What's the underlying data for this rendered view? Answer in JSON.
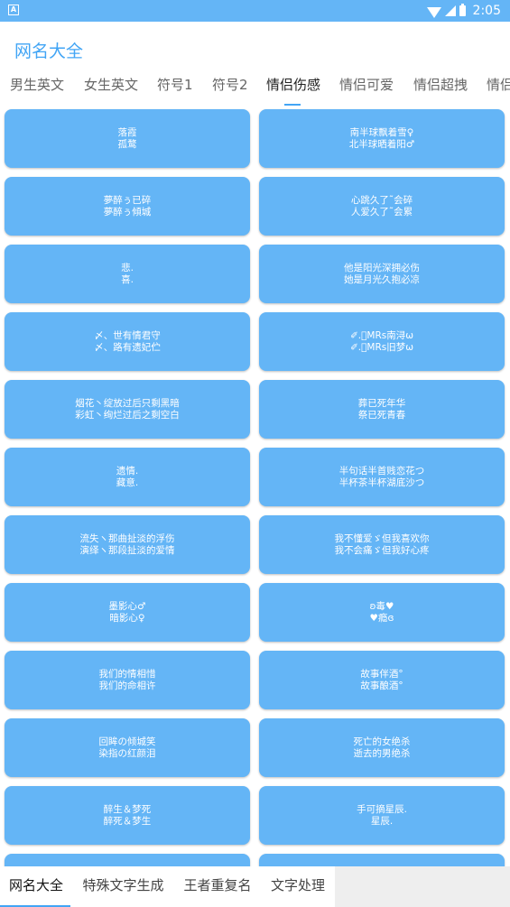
{
  "status_bar": {
    "notification_icon": "A",
    "time": "2:05",
    "icons": [
      "wifi-icon",
      "signal-icon",
      "battery-icon"
    ]
  },
  "app_bar": {
    "title": "网名大全"
  },
  "tabs": [
    {
      "label": "男生英文"
    },
    {
      "label": "女生英文"
    },
    {
      "label": "符号1"
    },
    {
      "label": "符号2"
    },
    {
      "label": "情侣伤感",
      "active": true
    },
    {
      "label": "情侣可爱"
    },
    {
      "label": "情侣超拽"
    },
    {
      "label": "情侣"
    }
  ],
  "cards": [
    {
      "line1": "落霞",
      "line2": "孤鹜"
    },
    {
      "line1": "南半球飘着雪♀",
      "line2": "北半球晒着阳♂"
    },
    {
      "line1": "夢醉ぅ已碎",
      "line2": "夢醉ぅ傾城"
    },
    {
      "line1": "心跳久了˜会碎",
      "line2": "人爱久了˜会累"
    },
    {
      "line1": "悲.",
      "line2": "喜."
    },
    {
      "line1": "他是阳光深拥必伤",
      "line2": "她是月光久抱必凉"
    },
    {
      "line1": "〆、世有情君守",
      "line2": "〆、路有遗妃伫"
    },
    {
      "line1": "✐.ﾞMRs南浔ω",
      "line2": "✐.ﾞMRs旧梦ω"
    },
    {
      "line1": "烟花丶绽放过后只剩黑暗",
      "line2": "彩虹丶绚烂过后之剩空白"
    },
    {
      "line1": "葬已死年华",
      "line2": "祭已死青春"
    },
    {
      "line1": "遗情.",
      "line2": "藏意."
    },
    {
      "line1": "半句话半首贱恋花つ",
      "line2": "半杯茶半杯湖底沙つ"
    },
    {
      "line1": "流失ヽ那曲扯淡的浮伤",
      "line2": "演绎ヽ那段扯淡的爱情"
    },
    {
      "line1": "我不懂爱ゞ但我喜欢你",
      "line2": "我不会痛ゞ但我好心疼"
    },
    {
      "line1": "墨影心♂",
      "line2": "暗影心♀"
    },
    {
      "line1": "ʚ毒♥",
      "line2": "♥瘾ɞ"
    },
    {
      "line1": "我们的情相惜",
      "line2": "我们的命相许"
    },
    {
      "line1": "故事伴酒°",
      "line2": "故事酿酒°"
    },
    {
      "line1": "回眸の倾城笑",
      "line2": "染指の红颜泪"
    },
    {
      "line1": "死亡的女绝杀",
      "line2": "逝去的男绝杀"
    },
    {
      "line1": "醉生＆梦死",
      "line2": "醉死＆梦生"
    },
    {
      "line1": "手可摘星辰.",
      "line2": "星辰."
    },
    {
      "line1": "",
      "line2": ""
    },
    {
      "line1": "",
      "line2": ""
    }
  ],
  "bottom_nav": [
    {
      "label": "网名大全",
      "active": true
    },
    {
      "label": "特殊文字生成"
    },
    {
      "label": "王者重复名"
    },
    {
      "label": "文字处理"
    }
  ],
  "colors": {
    "primary": "#64b5f6",
    "accent": "#42a5f5",
    "text_dark": "#222222",
    "text_muted": "#666666"
  }
}
